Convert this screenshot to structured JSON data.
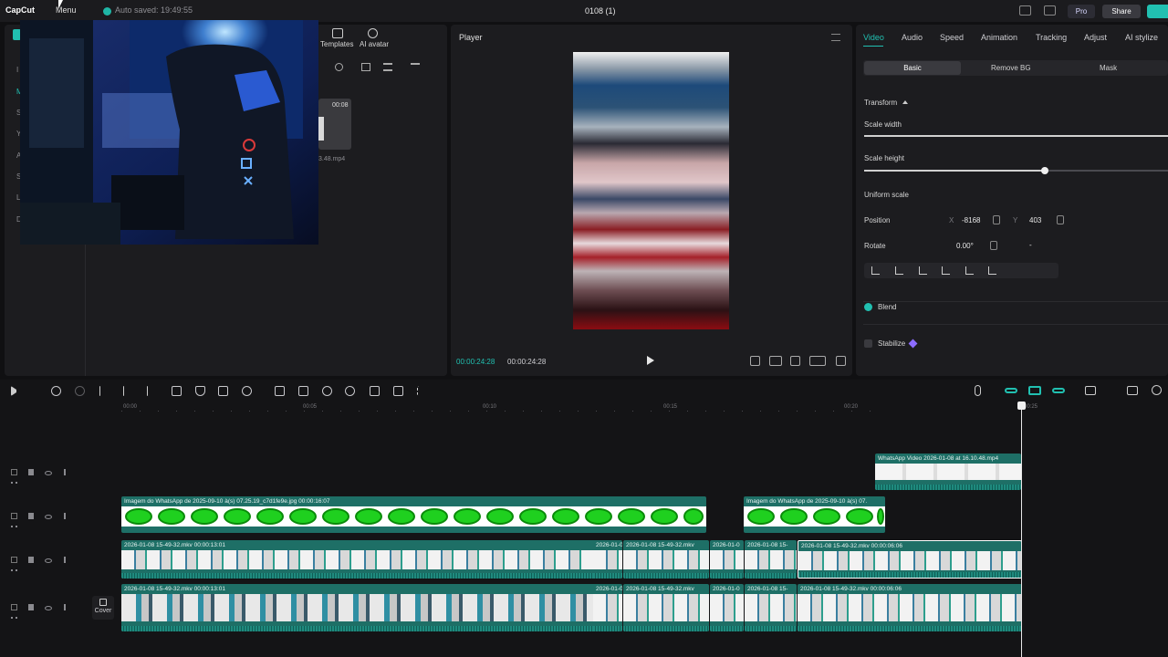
{
  "titlebar": {
    "logo": "CapCut",
    "menu": "Menu",
    "autosave": "Auto saved: 19:49:55",
    "project": "0108 (1)",
    "pro": "Pro",
    "share": "Share"
  },
  "left": {
    "templates": "Templates",
    "ai_avatar": "AI avatar",
    "media_duration": "00:08",
    "media_name": "3.48.mp4",
    "rail_letters": [
      "M",
      "I",
      "M",
      "S",
      "Y",
      "A",
      "S",
      "L",
      "D"
    ]
  },
  "player": {
    "title": "Player",
    "current_time": "00:00:24:28",
    "total_time": "00:00:24:28"
  },
  "props": {
    "tabs": [
      "Video",
      "Audio",
      "Speed",
      "Animation",
      "Tracking",
      "Adjust",
      "AI stylize"
    ],
    "subtabs": [
      "Basic",
      "Remove BG",
      "Mask"
    ],
    "transform": "Transform",
    "scale_width": "Scale width",
    "scale_width_level": 1.0,
    "scale_height": "Scale height",
    "scale_height_level": 0.6,
    "uniform_scale": "Uniform scale",
    "position": "Position",
    "pos_x_label": "X",
    "pos_x": "-8168",
    "pos_y_label": "Y",
    "pos_y": "403",
    "rotate": "Rotate",
    "rotate_value": "0.00°",
    "rotate_extra": "-",
    "blend": "Blend",
    "stabilize": "Stabilize"
  },
  "timeline": {
    "ruler": [
      "00:00",
      "00:05",
      "00:10",
      "00:15",
      "00:20",
      "00:25"
    ],
    "cover": "Cover",
    "clips": {
      "track1_clip": "WhatsApp Video 2026-01-08 at 16.10.48.mp4",
      "track2_clip1": "Imagem do WhatsApp de 2025-09-10 à(s) 07.25.19_c7d1fe9e.jpg   00:00:16:07",
      "track2_clip2": "Imagem do WhatsApp de 2025-09-10 à(s) 07.",
      "track3_clip1": "2026-01-08 15-49-32.mkv  00:00:13:01",
      "track3_clip2": "2026-01-0",
      "track3_clip3": "2026-01-08 15-49-32.mkv",
      "track3_clip4": "2026-01-0",
      "track3_clip5": "2026-01-08 15-",
      "track3_clip6": "2026-01-08 15-49-32.mkv   00:00:06:06",
      "track4_clip1": "2026-01-08 15-49-32.mkv  00:00:13:01",
      "track4_clip2": "2026-01-0",
      "track4_clip3": "2026-01-08 15-49-32.mkv",
      "track4_clip4": "2026-01-0",
      "track4_clip5": "2026-01-08 15-",
      "track4_clip6": "2026-01-08 15-49-32.mkv   00:00:06:06"
    }
  },
  "colors": {
    "accent": "#21c0b1",
    "clip_teal": "#1e6f66",
    "green_screen": "#1fd01f"
  }
}
